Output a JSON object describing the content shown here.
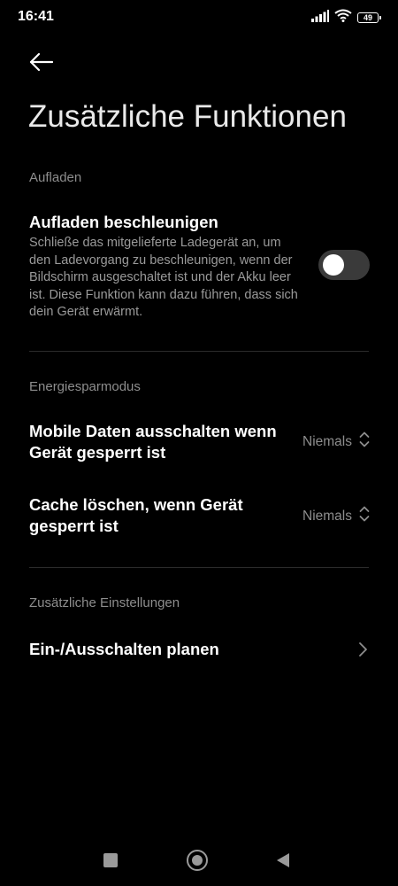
{
  "status_bar": {
    "time": "16:41",
    "battery_level": "49",
    "icons": [
      "signal-icon",
      "wifi-icon",
      "battery-icon"
    ]
  },
  "header": {
    "back_icon": "arrow-left-icon",
    "title": "Zusätzliche Funktionen"
  },
  "sections": {
    "charging": {
      "header": "Aufladen",
      "fast_charge": {
        "title": "Aufladen beschleunigen",
        "description": "Schließe das mitgelieferte Ladegerät an, um den Ladevorgang zu beschleunigen, wenn der Bildschirm ausgeschaltet ist und der Akku leer ist. Diese Funktion kann dazu führen, dass sich dein Gerät erwärmt.",
        "enabled": false
      }
    },
    "power_saving": {
      "header": "Energiesparmodus",
      "mobile_data": {
        "title": "Mobile Daten ausschalten wenn Gerät gesperrt ist",
        "value": "Niemals",
        "icon": "chevron-up-down-icon"
      },
      "clear_cache": {
        "title": "Cache löschen, wenn Gerät gesperrt ist",
        "value": "Niemals",
        "icon": "chevron-up-down-icon"
      }
    },
    "additional": {
      "header": "Zusätzliche Einstellungen",
      "schedule_power": {
        "title": "Ein-/Ausschalten planen",
        "icon": "chevron-right-icon"
      }
    }
  },
  "nav_bar": {
    "icons": [
      "recents-icon",
      "home-icon",
      "back-icon"
    ]
  },
  "colors": {
    "background": "#000000",
    "title": "#e9e9e9",
    "text_primary": "#ffffff",
    "text_secondary": "#8d8d8d",
    "toggle_off_track": "#3a3a3a",
    "divider": "#2b2b2b"
  }
}
